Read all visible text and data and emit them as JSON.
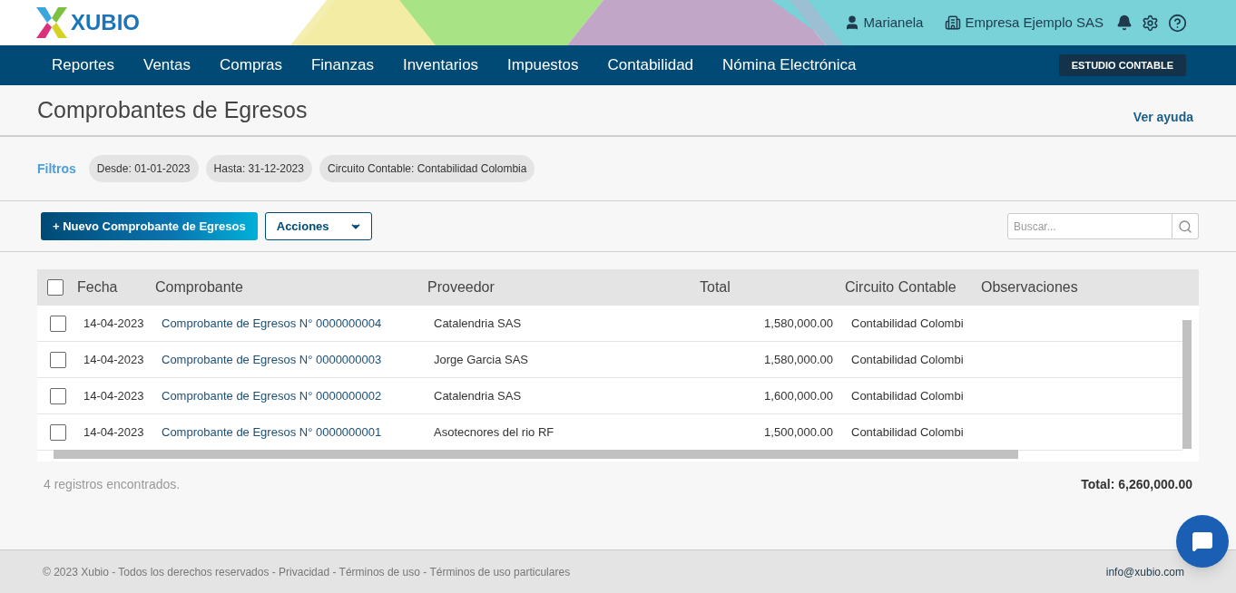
{
  "header": {
    "logo": "XUBIO",
    "user": "Marianela",
    "company": "Empresa Ejemplo SAS"
  },
  "nav": {
    "items": [
      "Reportes",
      "Ventas",
      "Compras",
      "Finanzas",
      "Inventarios",
      "Impuestos",
      "Contabilidad",
      "Nómina Electrónica"
    ],
    "badge": "ESTUDIO CONTABLE"
  },
  "page": {
    "title": "Comprobantes de Egresos",
    "help_link": "Ver ayuda"
  },
  "filters": {
    "label": "Filtros",
    "chips": [
      {
        "name": "Desde:",
        "value": "01-01-2023"
      },
      {
        "name": "Hasta:",
        "value": "31-12-2023"
      },
      {
        "name": "Circuito Contable:",
        "value": "Contabilidad Colombia"
      }
    ]
  },
  "toolbar": {
    "new_button": "+ Nuevo Comprobante de Egresos",
    "actions_button": "Acciones",
    "search": {
      "placeholder": "Buscar..."
    }
  },
  "table": {
    "select_all_checked": false,
    "columns": [
      "Fecha",
      "Comprobante",
      "Proveedor",
      "Total",
      "Circuito Contable",
      "Observaciones"
    ],
    "rows": [
      {
        "checked": false,
        "cells": [
          "14-04-2023",
          "Comprobante de Egresos N° 0000000004",
          "Catalendria SAS",
          "1,580,000.00",
          "Contabilidad Colombi"
        ]
      },
      {
        "checked": false,
        "cells": [
          "14-04-2023",
          "Comprobante de Egresos N° 0000000003",
          "Jorge Garcia SAS",
          "1,580,000.00",
          "Contabilidad Colombi"
        ]
      },
      {
        "checked": false,
        "cells": [
          "14-04-2023",
          "Comprobante de Egresos N° 0000000002",
          "Catalendria SAS",
          "1,600,000.00",
          "Contabilidad Colombi"
        ]
      },
      {
        "checked": false,
        "cells": [
          "14-04-2023",
          "Comprobante de Egresos N° 0000000001",
          "Asotecnores del rio RF",
          "1,500,000.00",
          "Contabilidad Colombi"
        ]
      }
    ]
  },
  "summary": {
    "count": "4 registros encontrados.",
    "total": "Total: 6,260,000.00"
  },
  "footer": {
    "links": [
      "© 2023 Xubio - Todos los derechos reservados - Privacidad - Términos de uso - Términos de uso particulares"
    ],
    "email": "info@xubio.com"
  }
}
